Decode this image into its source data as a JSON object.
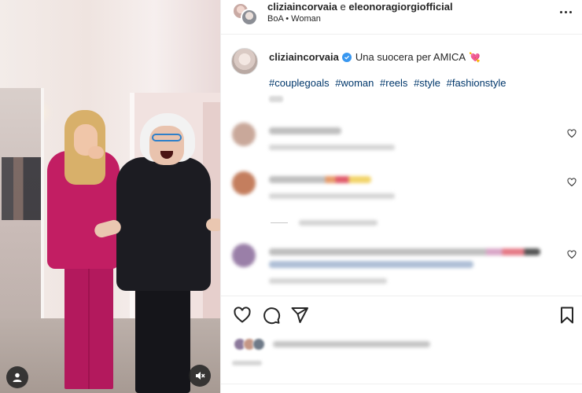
{
  "header": {
    "user1": "cliziaincorvaia",
    "conjunction": "e",
    "user2": "eleonoragiorgiofficial",
    "subtitle": "BoA • Woman",
    "more_icon": "more-horizontal-icon"
  },
  "caption": {
    "username": "cliziaincorvaia",
    "text": "Una suocera per AMICA",
    "emoji": "💘",
    "hashtags": [
      "#couplegoals",
      "#woman",
      "#reels",
      "#style",
      "#fashionstyle"
    ]
  },
  "comments_section": {
    "comment_count_visible": 3,
    "like_icon": "heart-outline-icon"
  },
  "media": {
    "user_tag_icon": "user-icon",
    "mute_icon": "speaker-muted-icon"
  },
  "actions": {
    "like_icon": "heart-outline-icon",
    "comment_icon": "comment-bubble-icon",
    "share_icon": "paper-plane-icon",
    "save_icon": "bookmark-icon"
  },
  "colors": {
    "hashtag": "#00376b",
    "verified": "#3897f0",
    "text": "#262626",
    "divider": "#efefef"
  }
}
